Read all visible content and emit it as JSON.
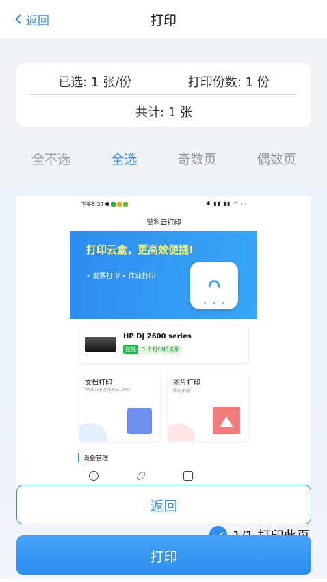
{
  "header": {
    "back_label": "返回",
    "title": "打印"
  },
  "summary": {
    "selected": "已选: 1 张/份",
    "copies": "打印份数: 1 份",
    "total": "共计: 1 张"
  },
  "select_tabs": [
    {
      "label": "全不选",
      "active": false
    },
    {
      "label": "全选",
      "active": true
    },
    {
      "label": "奇数页",
      "active": false
    },
    {
      "label": "偶数页",
      "active": false
    }
  ],
  "preview": {
    "status_time": "下午5:27",
    "status_right": "✱ ▮▮ ▮▮ ◠ ▭",
    "app_title": "链科云打印",
    "banner_headline": "打印云盒，更高效便捷!",
    "banner_sub": "• 发票打印 • 作业打印",
    "printer_name": "HP DJ 2600 series",
    "printer_status": "在线",
    "printer_available": "3 个打印机可用",
    "card_doc_title": "文档打印",
    "card_doc_sub": "WORD/PDF/EXCEL/PPT",
    "card_img_title": "图片打印",
    "card_img_sub": "照片/相册",
    "section_title": "设备管理"
  },
  "actions": {
    "return_label": "返回",
    "print_label": "打印",
    "page_check_label": "1/1 打印此页"
  },
  "colors": {
    "accent": "#2f8ef5",
    "background": "#f2f3f6",
    "online_green": "#23b54a"
  }
}
